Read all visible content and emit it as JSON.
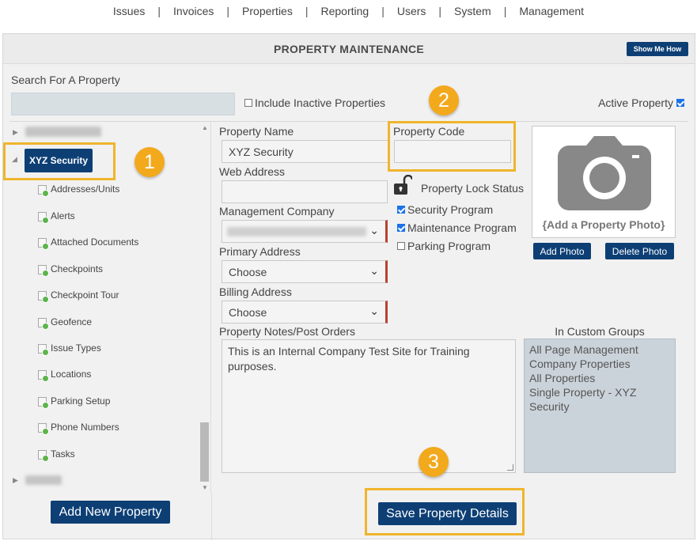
{
  "topnav": {
    "items": [
      "Issues",
      "Invoices",
      "Properties",
      "Reporting",
      "Users",
      "System",
      "Management"
    ],
    "separator": "|"
  },
  "header": {
    "title": "PROPERTY MAINTENANCE",
    "show_me_how": "Show Me How"
  },
  "search": {
    "label": "Search For A Property",
    "value": "",
    "include_inactive_label": "Include Inactive Properties",
    "include_inactive_checked": false,
    "active_property_label": "Active Property",
    "active_property_checked": true
  },
  "tree": {
    "selected_node": "XYZ Security",
    "children": [
      "Addresses/Units",
      "Alerts",
      "Attached Documents",
      "Checkpoints",
      "Checkpoint Tour",
      "Geofence",
      "Issue Types",
      "Locations",
      "Parking Setup",
      "Phone Numbers",
      "Tasks"
    ],
    "add_button": "Add New Property"
  },
  "form": {
    "property_name_label": "Property Name",
    "property_name_value": "XYZ Security",
    "property_code_label": "Property Code",
    "property_code_value": "",
    "web_address_label": "Web Address",
    "web_address_value": "",
    "lock_status_label": "Property Lock Status",
    "management_company_label": "Management Company",
    "primary_address_label": "Primary Address",
    "primary_address_value": "Choose",
    "billing_address_label": "Billing Address",
    "billing_address_value": "Choose",
    "programs": [
      {
        "label": "Security Program",
        "checked": true
      },
      {
        "label": "Maintenance Program",
        "checked": true
      },
      {
        "label": "Parking Program",
        "checked": false
      }
    ],
    "notes_label": "Property Notes/Post Orders",
    "notes_value": "This is an Internal Company Test Site for Training purposes.",
    "save_button": "Save Property Details"
  },
  "photo": {
    "caption": "{Add a Property Photo}",
    "add_button": "Add Photo",
    "delete_button": "Delete Photo"
  },
  "groups": {
    "label": "In Custom Groups",
    "items": [
      "All Page Management Company Properties",
      "All Properties",
      "Single Property - XYZ Security"
    ]
  },
  "callouts": [
    "1",
    "2",
    "3"
  ],
  "colors": {
    "primary_button": "#0d3f75",
    "callout": "#f3a91c",
    "highlight_border": "#f0b52d",
    "required_marker": "#b8432f"
  }
}
